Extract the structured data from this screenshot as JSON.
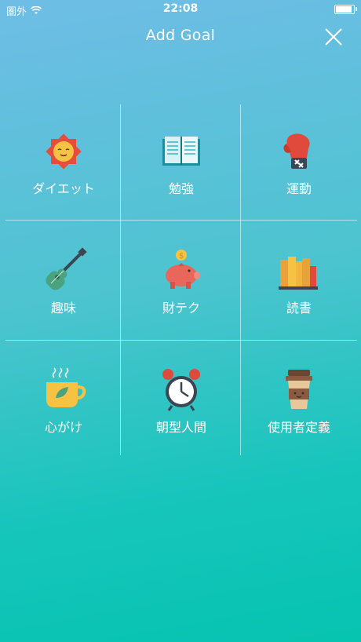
{
  "status_bar": {
    "carrier": "圏外",
    "time": "22:08",
    "battery_level": 1.0
  },
  "nav": {
    "title": "Add Goal",
    "close_icon": "close-icon"
  },
  "goals": [
    {
      "label": "ダイエット",
      "icon": "sun-face-icon"
    },
    {
      "label": "勉強",
      "icon": "open-book-icon"
    },
    {
      "label": "運動",
      "icon": "boxing-glove-icon"
    },
    {
      "label": "趣味",
      "icon": "guitar-icon"
    },
    {
      "label": "財テク",
      "icon": "piggy-bank-icon"
    },
    {
      "label": "読書",
      "icon": "books-icon"
    },
    {
      "label": "心がけ",
      "icon": "tea-cup-icon"
    },
    {
      "label": "朝型人間",
      "icon": "alarm-clock-icon"
    },
    {
      "label": "使用者定義",
      "icon": "coffee-cup-icon"
    }
  ],
  "colors": {
    "background_top": "#6fbde6",
    "background_bottom": "#06c4b0",
    "text": "#ffffff"
  }
}
